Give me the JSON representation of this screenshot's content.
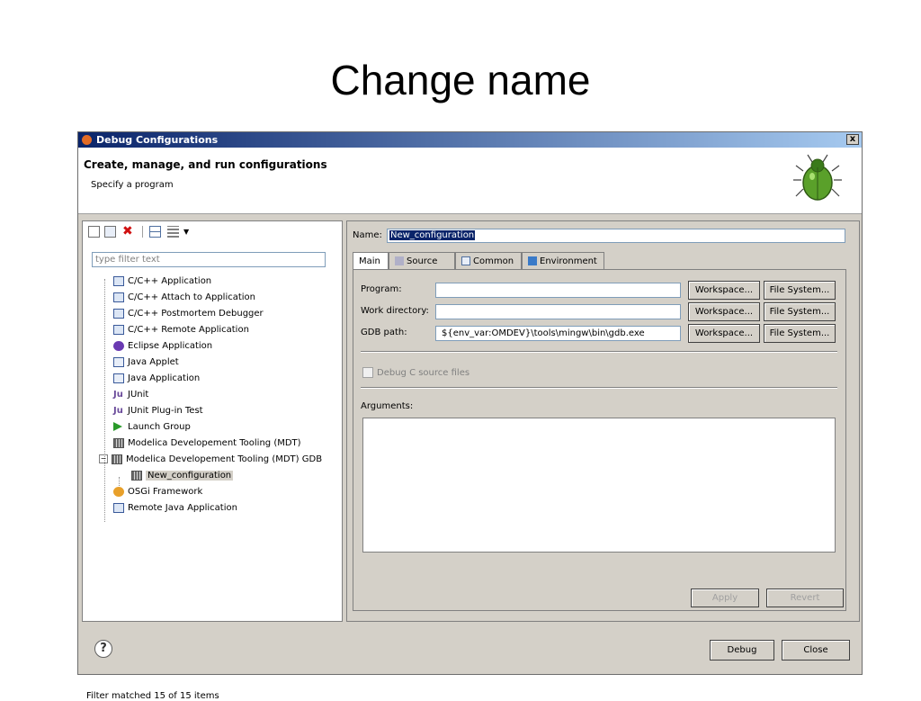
{
  "slide": {
    "title": "Change name"
  },
  "window": {
    "title": "Debug Configurations",
    "close_glyph": "x",
    "header_title": "Create, manage, and run configurations",
    "header_subtitle": "Specify a program"
  },
  "left": {
    "filter_placeholder": "type filter text",
    "tree": [
      {
        "label": "C/C++ Application",
        "icon": "c-app-icon"
      },
      {
        "label": "C/C++ Attach to Application",
        "icon": "c-app-icon"
      },
      {
        "label": "C/C++ Postmortem Debugger",
        "icon": "c-app-icon"
      },
      {
        "label": "C/C++ Remote Application",
        "icon": "c-app-icon"
      },
      {
        "label": "Eclipse Application",
        "icon": "eclipse-icon"
      },
      {
        "label": "Java Applet",
        "icon": "java-applet-icon"
      },
      {
        "label": "Java Application",
        "icon": "java-app-icon"
      },
      {
        "label": "JUnit",
        "icon": "junit-icon"
      },
      {
        "label": "JUnit Plug-in Test",
        "icon": "junit-plugin-icon"
      },
      {
        "label": "Launch Group",
        "icon": "launch-group-icon"
      },
      {
        "label": "Modelica Developement Tooling (MDT)",
        "icon": "mdt-icon"
      },
      {
        "label": "Modelica Developement Tooling (MDT) GDB",
        "icon": "mdt-icon"
      },
      {
        "label": "New_configuration",
        "icon": "mdt-icon"
      },
      {
        "label": "OSGi Framework",
        "icon": "osgi-icon"
      },
      {
        "label": "Remote Java Application",
        "icon": "remote-java-icon"
      }
    ],
    "status": "Filter matched 15 of 15 items"
  },
  "right": {
    "name_label": "Name:",
    "name_value": "New_configuration",
    "tabs": [
      "Main",
      "Source",
      "Common",
      "Environment"
    ],
    "program_label": "Program:",
    "program_value": "",
    "workdir_label": "Work directory:",
    "workdir_value": "",
    "gdb_label": "GDB path:",
    "gdb_value": "${env_var:OMDEV}\\tools\\mingw\\bin\\gdb.exe",
    "workspace_button": "Workspace...",
    "filesystem_button": "File System...",
    "debug_c_label": "Debug C source files",
    "arguments_label": "Arguments:",
    "apply_button": "Apply",
    "revert_button": "Revert"
  },
  "footer": {
    "help_glyph": "?",
    "debug_button": "Debug",
    "close_button": "Close"
  }
}
